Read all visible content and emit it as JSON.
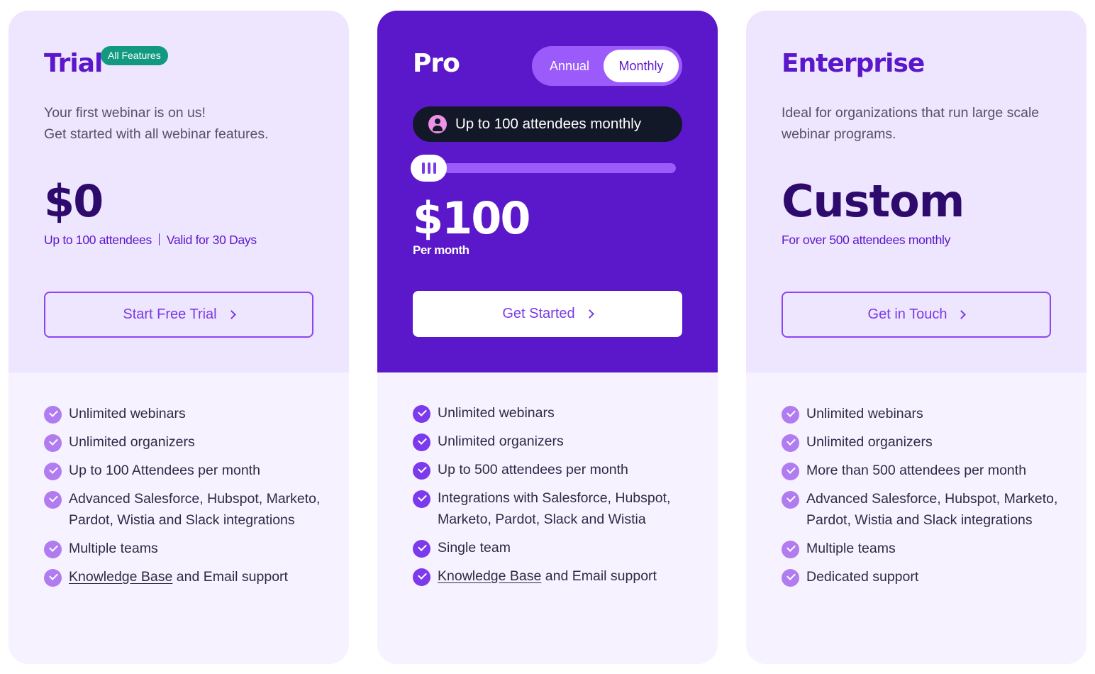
{
  "colors": {
    "accent": "#5B18CB",
    "pro_bg": "#5B18CB",
    "card_top_bg": "#EEE5FF",
    "card_bottom_bg": "#F6F2FF",
    "badge_bg": "#129A80",
    "check_light": "#B07CF0",
    "check_pro": "#7C3AED",
    "pill_bg": "#121827"
  },
  "plans": {
    "trial": {
      "title": "Trial",
      "badge": "All Features",
      "desc_lines": [
        "Your first webinar is on us!",
        "Get started with all webinar features."
      ],
      "price": "$0",
      "subline_left": "Up to 100 attendees",
      "subline_right": "Valid for 30 Days",
      "cta": "Start Free Trial",
      "features": [
        "Unlimited webinars",
        "Unlimited organizers",
        "Up to 100 Attendees per month",
        "Advanced Salesforce, Hubspot, Marketo, Pardot, Wistia and Slack integrations",
        "Multiple teams"
      ],
      "support_link": "Knowledge Base",
      "support_rest": " and Email support"
    },
    "pro": {
      "title": "Pro",
      "toggle": {
        "options": [
          "Annual",
          "Monthly"
        ],
        "selected": "Monthly"
      },
      "attendee_label": "Up to 100 attendees monthly",
      "slider": {
        "value": 100,
        "position_fraction": 0.0
      },
      "price": "$100",
      "period": "Per month",
      "cta": "Get Started",
      "features": [
        "Unlimited webinars",
        "Unlimited organizers",
        "Up to 500 attendees per month",
        "Integrations with Salesforce, Hubspot, Marketo, Pardot, Slack and Wistia",
        "Single team"
      ],
      "support_link": "Knowledge Base",
      "support_rest": " and Email support"
    },
    "enterprise": {
      "title": "Enterprise",
      "desc": "Ideal for organizations that run large scale webinar programs.",
      "price": "Custom",
      "subline": "For over 500 attendees monthly",
      "cta": "Get in Touch",
      "features": [
        "Unlimited webinars",
        "Unlimited organizers",
        "More than 500 attendees per month",
        "Advanced Salesforce, Hubspot, Marketo, Pardot, Wistia and Slack integrations",
        "Multiple teams",
        "Dedicated support"
      ]
    }
  }
}
